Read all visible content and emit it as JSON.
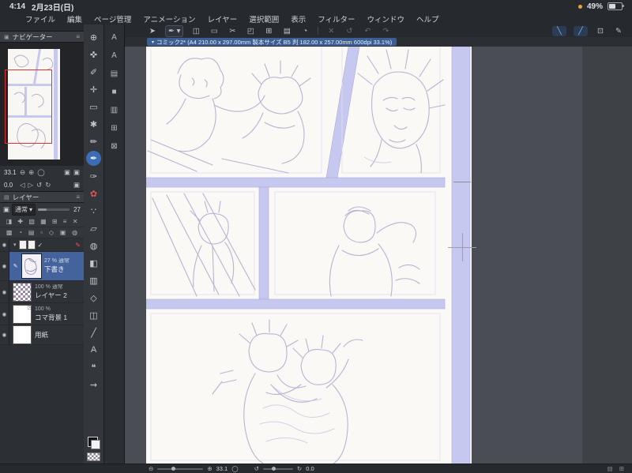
{
  "colors": {
    "accent": "#3c6cb4",
    "selection": "#44639c",
    "lavender": "#c7c8ef",
    "page_white": "#faf9f6",
    "view_rect_red": "#e03232"
  },
  "status_bar": {
    "time": "4:14",
    "date": "2月23日(日)",
    "battery": "49%"
  },
  "menu": {
    "items": [
      {
        "label": "ファイル"
      },
      {
        "label": "編集"
      },
      {
        "label": "ページ管理"
      },
      {
        "label": "アニメーション"
      },
      {
        "label": "レイヤー"
      },
      {
        "label": "選択範囲"
      },
      {
        "label": "表示"
      },
      {
        "label": "フィルター"
      },
      {
        "label": "ウィンドウ"
      },
      {
        "label": "ヘルプ"
      }
    ]
  },
  "glyphs": {
    "logo": "✦",
    "minus": "⊖",
    "plus": "⊕",
    "reset": "◯",
    "undo": "↺",
    "redo": "↻",
    "left": "◁",
    "right": "▷",
    "caret_down": "▾",
    "check": "✓",
    "eye": "◉",
    "pencil": "✎",
    "menu": "≡",
    "panel": "▣",
    "grid": "⊞",
    "list": "▤",
    "badge": "◳"
  },
  "top_toolbar": {
    "icons": [
      {
        "name": "operation-tool-icon",
        "glyph": "➤"
      },
      {
        "name": "brush-preset-dropdown",
        "glyph": "✒ ▾",
        "cls": "boxed"
      },
      {
        "name": "selection-launcher-icon",
        "glyph": "◫"
      },
      {
        "name": "marquee-icon",
        "glyph": "▭"
      },
      {
        "name": "lasso-icon",
        "glyph": "✂"
      },
      {
        "name": "frame-icon",
        "glyph": "◰"
      },
      {
        "name": "grid-icon",
        "glyph": "⊞"
      },
      {
        "name": "material-icon",
        "glyph": "▤"
      },
      {
        "name": "timelapse-icon",
        "glyph": "◔"
      },
      {
        "name": "toolbar-separator",
        "glyph": "",
        "cls": "sep"
      },
      {
        "name": "clear-icon",
        "glyph": "✕",
        "cls": "dim"
      },
      {
        "name": "reset-view-icon",
        "glyph": "↺",
        "cls": "dim"
      },
      {
        "name": "undo-icon",
        "glyph": "↶",
        "cls": "dim"
      },
      {
        "name": "redo-icon",
        "glyph": "↷",
        "cls": "dim"
      },
      {
        "name": "toolbar-spacer",
        "glyph": "",
        "cls": "grow"
      },
      {
        "name": "snap-special-ruler-icon",
        "glyph": "╲",
        "cls": "active"
      },
      {
        "name": "snap-ruler-icon",
        "glyph": "╱",
        "cls": "active"
      },
      {
        "name": "snap-grid-icon",
        "glyph": "⊡"
      },
      {
        "name": "toolbar-settings-icon",
        "glyph": "✎"
      }
    ]
  },
  "doc_tab": {
    "title": "コミック2* (A4 210.00 x 297.00mm 製本サイズ B5 判 182.00 x 257.00mm 600dpi 33.1%)"
  },
  "navigator": {
    "title": "ナビゲーター",
    "zoom": "33.1",
    "rotation": "0.0"
  },
  "layers": {
    "title": "レイヤー",
    "blend_mode": "通常",
    "opacity": "27",
    "command_icons_row1": [
      "◨",
      "✚",
      "▧",
      "▦",
      "⊞",
      "≡",
      "✕"
    ],
    "command_icons_row2": [
      "▩",
      "◔",
      "▤",
      "▫",
      "◇",
      "▣",
      "◍"
    ],
    "items": [
      {
        "info": "27 % 通常",
        "name": "下書き",
        "selected": true
      },
      {
        "info": "100 % 通常",
        "name": "レイヤー 2",
        "selected": false
      },
      {
        "info": "100 %",
        "name": "コマ背景 1",
        "selected": false
      },
      {
        "info": "",
        "name": "用紙",
        "selected": false
      }
    ]
  },
  "tools": {
    "primary": [
      {
        "name": "zoom-tool-icon",
        "glyph": "⊕"
      },
      {
        "name": "hand-tool-icon",
        "glyph": "✜"
      },
      {
        "name": "eyedropper-tool-icon",
        "glyph": "✐"
      },
      {
        "name": "move-tool-icon",
        "glyph": "✛"
      },
      {
        "name": "selection-tool-icon",
        "glyph": "▭"
      },
      {
        "name": "auto-select-tool-icon",
        "glyph": "✱"
      },
      {
        "name": "pencil-tool-icon",
        "glyph": "✏"
      },
      {
        "name": "pen-tool-icon",
        "glyph": "✒",
        "cls": "active"
      },
      {
        "name": "brush-tool-icon",
        "glyph": "✑"
      },
      {
        "name": "decoration-tool-icon",
        "glyph": "✿",
        "cls": "red"
      },
      {
        "name": "airbrush-tool-icon",
        "glyph": "∵"
      },
      {
        "name": "eraser-tool-icon",
        "glyph": "▱"
      },
      {
        "name": "blend-tool-icon",
        "glyph": "◍"
      },
      {
        "name": "fill-tool-icon",
        "glyph": "◧"
      },
      {
        "name": "gradient-tool-icon",
        "glyph": "▥"
      },
      {
        "name": "figure-tool-icon",
        "glyph": "◇"
      },
      {
        "name": "frame-border-tool-icon",
        "glyph": "◫"
      },
      {
        "name": "ruler-tool-icon",
        "glyph": "╱"
      },
      {
        "name": "text-tool-icon",
        "glyph": "A"
      },
      {
        "name": "balloon-tool-icon",
        "glyph": "❝"
      },
      {
        "name": "line-correction-tool-icon",
        "glyph": "⇝"
      }
    ],
    "secondary": [
      {
        "name": "auto-action-panel-icon",
        "glyph": "A"
      },
      {
        "name": "text-style-panel-icon",
        "glyph": "A"
      },
      {
        "name": "material-panel-icon",
        "glyph": "▤"
      },
      {
        "name": "color-panel-icon",
        "glyph": "■"
      },
      {
        "name": "pattern-panel-icon",
        "glyph": "▥"
      },
      {
        "name": "workspace-panel-icon",
        "glyph": "⊞"
      },
      {
        "name": "close-panel-icon",
        "glyph": "⊠"
      }
    ]
  },
  "bottom_bar": {
    "zoom": "33.1",
    "rotation": "0.0"
  }
}
